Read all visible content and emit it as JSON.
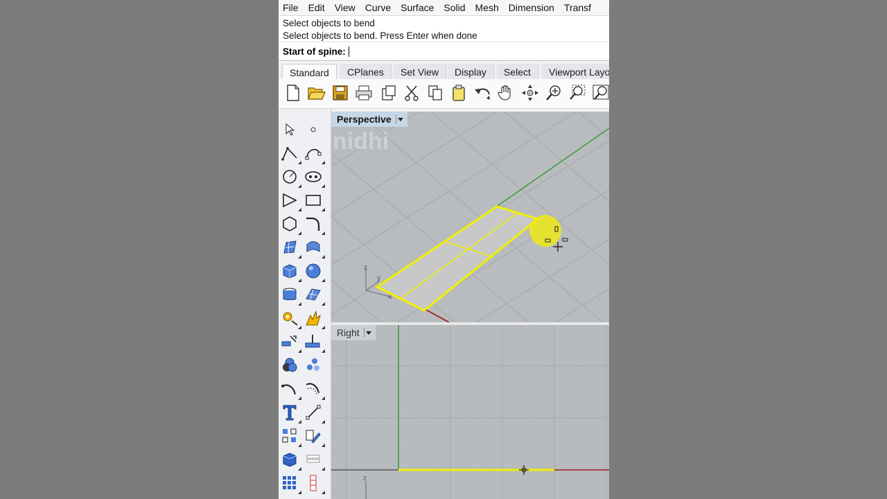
{
  "menu": [
    "File",
    "Edit",
    "View",
    "Curve",
    "Surface",
    "Solid",
    "Mesh",
    "Dimension",
    "Transf"
  ],
  "command_history": [
    "Select objects to bend",
    "Select objects to bend. Press Enter when done"
  ],
  "command_prompt": "Start of spine:",
  "tabs": [
    "Standard",
    "CPlanes",
    "Set View",
    "Display",
    "Select",
    "Viewport Layo"
  ],
  "active_tab": "Standard",
  "toolbar_icons": [
    "new-file-icon",
    "open-folder-icon",
    "save-icon",
    "print-icon",
    "import-icon",
    "cut-icon",
    "copy-icon",
    "paste-icon",
    "undo-icon",
    "pan-hand-icon",
    "rotate-view-icon",
    "zoom-icon",
    "zoom-window-icon",
    "zoom-extents-icon"
  ],
  "viewports": {
    "perspective": {
      "label": "Perspective",
      "watermark": "nidhi",
      "axis_z": "z",
      "axis_y": "y",
      "axis_x": "x"
    },
    "right": {
      "label": "Right",
      "axis_z": "z"
    }
  },
  "colors": {
    "selection": "#f0f000",
    "x_axis": "#a03030",
    "y_axis": "#3c9a3c",
    "highlight": "#f4f000"
  }
}
